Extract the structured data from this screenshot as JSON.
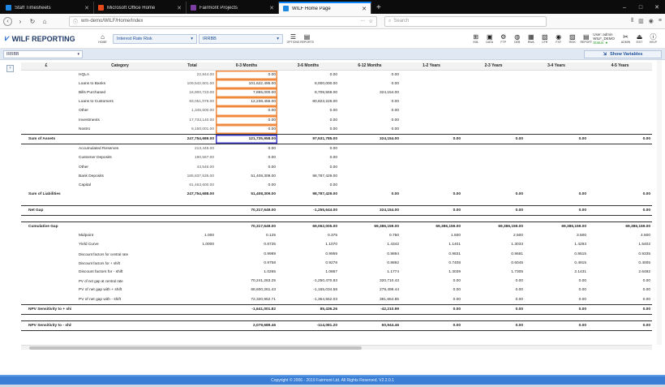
{
  "browser": {
    "tabs": [
      {
        "title": "Staff Timesheets",
        "color": "#1e88e5"
      },
      {
        "title": "Microsoft Office Home",
        "color": "#e64a19"
      },
      {
        "title": "Fairmont Projects",
        "color": "#7b3fa3"
      },
      {
        "title": "WILF Home Page",
        "color": "#1e88e5"
      }
    ],
    "url": "wm-demo/WILF/Home/Index",
    "search_placeholder": "Search"
  },
  "app": {
    "logo": "WILF REPORTING",
    "home_label": "HOME",
    "select_risk": "Interest Rate Risk",
    "select_model": "IRRBB",
    "options_label": "OPTIONS",
    "reports_label": "REPORTS",
    "tools": [
      "XML",
      "DATA",
      "FTP",
      "DEB",
      "RWA",
      "CFR",
      "FXF",
      "RISK",
      "REPORT"
    ],
    "user_line1": "User: admin",
    "user_line2": "WILF_DEMO",
    "user_status": "Status: ●",
    "admin_tools": [
      "ADMIN",
      "EXIT",
      "HELP"
    ]
  },
  "subbar": {
    "select_value": "IRRBB",
    "show_variables": "Show Variables"
  },
  "table": {
    "headers": [
      "£",
      "Category",
      "Total",
      "0-3 Months",
      "3-6 Months",
      "6-12 Months",
      "1-2 Years",
      "2-3 Years",
      "3-4 Years",
      "4-5 Years"
    ],
    "rows": [
      {
        "type": "asset",
        "label": "",
        "cat": "HQLA",
        "vals": [
          "22,844.00",
          "0.00",
          "0.00",
          "0.00",
          "",
          "",
          "",
          ""
        ]
      },
      {
        "type": "asset",
        "label": "",
        "cat": "Loans to Banks",
        "vals": [
          "109,542,501.00",
          "101,622,495.00",
          "8,000,000.00",
          "0.00",
          "",
          "",
          "",
          ""
        ]
      },
      {
        "type": "asset",
        "label": "",
        "cat": "Bills Purchased",
        "vals": [
          "16,900,723.00",
          "7,865,000.00",
          "8,708,559.00",
          "324,154.00",
          "",
          "",
          "",
          ""
        ]
      },
      {
        "type": "asset",
        "label": "",
        "cat": "Loans to Customers",
        "vals": [
          "93,051,079.00",
          "12,238,455.00",
          "80,823,226.00",
          "0.00",
          "",
          "",
          "",
          ""
        ]
      },
      {
        "type": "asset",
        "label": "",
        "cat": "Other",
        "vals": [
          "1,345,500.00",
          "0.00",
          "0.00",
          "0.00",
          "",
          "",
          "",
          ""
        ]
      },
      {
        "type": "asset",
        "label": "",
        "cat": "Investments",
        "vals": [
          "17,733,140.00",
          "0.00",
          "0.00",
          "0.00",
          "",
          "",
          "",
          ""
        ]
      },
      {
        "type": "asset",
        "label": "",
        "cat": "Nostro",
        "vals": [
          "9,150,001.00",
          "0.00",
          "0.00",
          "0.00",
          "",
          "",
          "",
          ""
        ]
      },
      {
        "type": "sum",
        "label": "Sum of Assets",
        "cat": "",
        "vals": [
          "247,754,689.00",
          "121,725,958.00",
          "97,531,785.00",
          "324,154.00",
          "0.00",
          "0.00",
          "0.00",
          "0.00"
        ]
      },
      {
        "type": "liab",
        "label": "",
        "cat": "Accumulated Reserves",
        "vals": [
          "213,445.00",
          "0.00",
          "0.00",
          "",
          "",
          "",
          "",
          ""
        ]
      },
      {
        "type": "liab",
        "label": "",
        "cat": "Customer Deposits",
        "vals": [
          "190,567.00",
          "0.00",
          "0.00",
          "",
          "",
          "",
          "",
          ""
        ]
      },
      {
        "type": "liab",
        "label": "",
        "cat": "Other",
        "vals": [
          "43,546.00",
          "0.00",
          "0.00",
          "",
          "",
          "",
          "",
          ""
        ]
      },
      {
        "type": "liab",
        "label": "",
        "cat": "Bank Deposits",
        "vals": [
          "185,837,535.00",
          "51,408,309.00",
          "98,787,429.00",
          "",
          "",
          "",
          "",
          ""
        ]
      },
      {
        "type": "liab",
        "label": "",
        "cat": "Capital",
        "vals": [
          "61,463,600.00",
          "0.00",
          "0.00",
          "",
          "",
          "",
          "",
          ""
        ]
      },
      {
        "type": "sumfirst",
        "label": "Sum of Liabilities",
        "cat": "",
        "vals": [
          "247,754,688.00",
          "51,408,309.00",
          "98,787,429.00",
          "0.00",
          "0.00",
          "0.00",
          "0.00",
          "0.00"
        ]
      },
      {
        "type": "blank"
      },
      {
        "type": "sum",
        "label": "Net Gap",
        "cat": "",
        "vals": [
          "",
          "70,317,649.00",
          "-1,255,644.00",
          "324,154.00",
          "0.00",
          "0.00",
          "0.00",
          "0.00"
        ]
      },
      {
        "type": "blank"
      },
      {
        "type": "sep",
        "label": "Cumulative Gap",
        "cat": "",
        "vals": [
          "",
          "70,317,649.00",
          "69,062,005.00",
          "69,386,159.00",
          "69,386,159.00",
          "69,386,159.00",
          "69,386,159.00",
          "69,386,159.00"
        ]
      },
      {
        "type": "calc",
        "label": "",
        "cat": "Midpoint",
        "vals": [
          "1.000",
          "0.125",
          "0.375",
          "0.750",
          "1.500",
          "2.500",
          "3.500",
          "4.500"
        ]
      },
      {
        "type": "calc",
        "label": "",
        "cat": "Yield Curve",
        "vals": [
          "1.0000",
          "0.8735",
          "1.1070",
          "1.4342",
          "1.1401",
          "1.3033",
          "1.4293",
          "1.5402"
        ]
      },
      {
        "type": "calc2",
        "label": "",
        "cat": "Discount factors for central rate",
        "vals": [
          "",
          "0.9989",
          "0.9959",
          "0.9894",
          "0.9831",
          "0.9681",
          "0.9515",
          "0.9335"
        ]
      },
      {
        "type": "calc2",
        "label": "",
        "cat": "Discount factors for + shift",
        "vals": [
          "",
          "0.9758",
          "0.9278",
          "0.8892",
          "0.7408",
          "0.6045",
          "0.4915",
          "0.4005"
        ]
      },
      {
        "type": "calc",
        "label": "",
        "cat": "Discount factors for - shift",
        "vals": [
          "",
          "1.0265",
          "1.0867",
          "1.1774",
          "1.3039",
          "1.7305",
          "2.1431",
          "2.6482"
        ]
      },
      {
        "type": "calc2",
        "label": "",
        "cat": "PV of net gap at central rate",
        "vals": [
          "",
          "70,241,263.25",
          "-1,250,470.83",
          "320,710.43",
          "0.00",
          "0.00",
          "0.00",
          "0.00"
        ]
      },
      {
        "type": "calc",
        "label": "",
        "cat": "PV of net gap with + shift",
        "vals": [
          "",
          "68,600,261.43",
          "-1,165,034.58",
          "278,499.44",
          "0.00",
          "0.00",
          "0.00",
          "0.00"
        ]
      },
      {
        "type": "calc",
        "label": "",
        "cat": "PV of net gap with - shift",
        "vals": [
          "",
          "72,320,952.71",
          "-1,364,552.03",
          "381,654.85",
          "0.00",
          "0.00",
          "0.00",
          "0.00"
        ]
      },
      {
        "type": "sum2",
        "label": "NPV Sensitivity to + shift",
        "cat": "",
        "vals": [
          "",
          "-1,641,001.82",
          "85,436.26",
          "-42,210.99",
          "0.00",
          "0.00",
          "0.00",
          "0.00"
        ]
      },
      {
        "type": "blank"
      },
      {
        "type": "sum2",
        "label": "NPV Sensitivity to - shift",
        "cat": "",
        "vals": [
          "",
          "2,079,689.46",
          "-114,081.20",
          "60,944.46",
          "0.00",
          "0.00",
          "0.00",
          "0.00"
        ]
      }
    ]
  },
  "footer": "Copyright © 2006 - 2019 Fairmont Ltd. All Rights Reserved. V2.2.0.1"
}
